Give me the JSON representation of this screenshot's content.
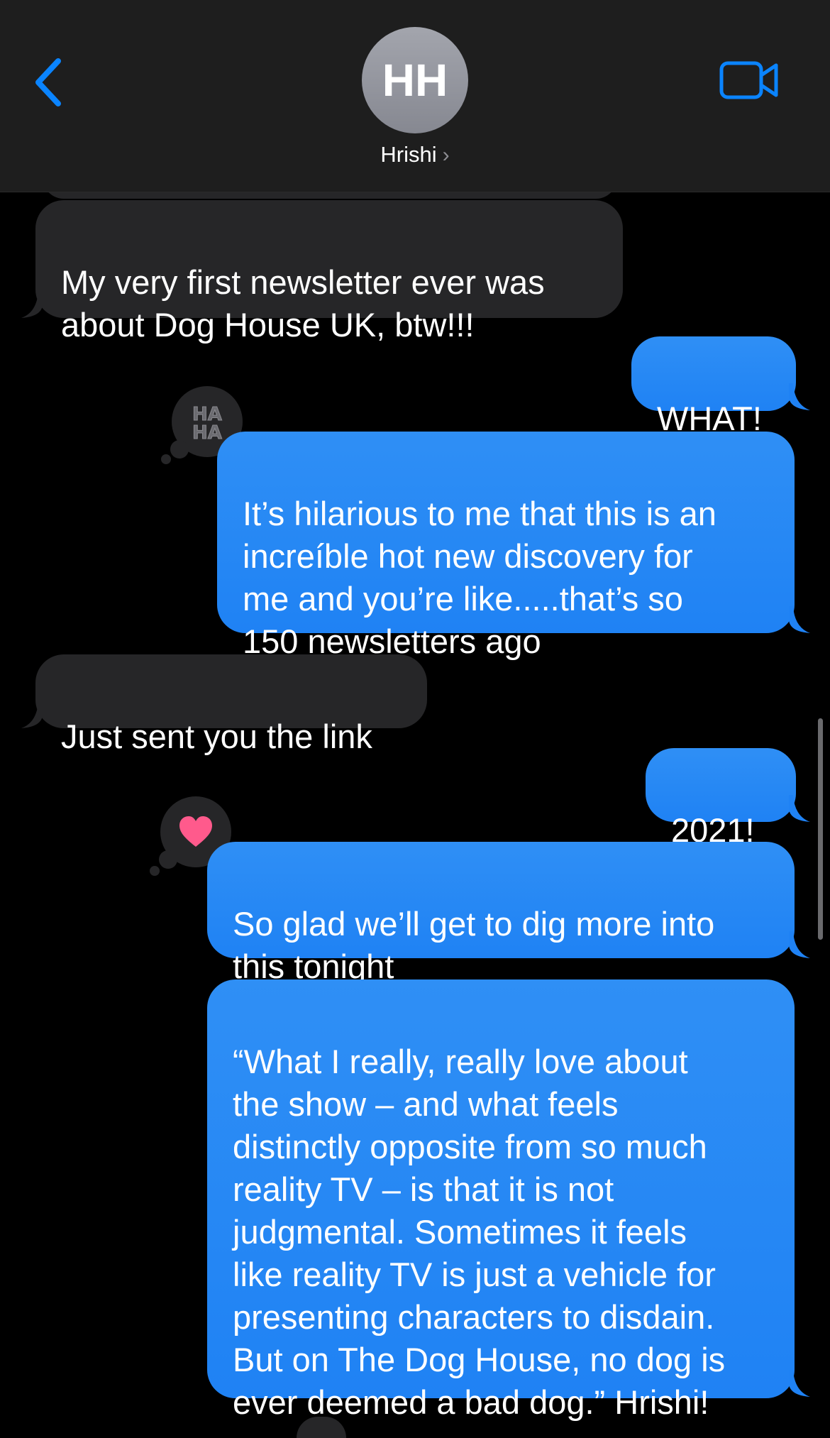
{
  "header": {
    "contact_initials": "HH",
    "contact_name": "Hrishi",
    "chevron": "›",
    "back_icon": "chevron-left-icon",
    "video_icon": "video-camera-icon",
    "accent_color": "#0a84ff"
  },
  "messages": [
    {
      "direction": "incoming",
      "text": "My very first newsletter ever was\nabout Dog House UK, btw!!!"
    },
    {
      "direction": "outgoing",
      "text": "WHAT!"
    },
    {
      "direction": "outgoing",
      "text": "It’s hilarious to me that this is an\nincreíble hot new discovery for\nme and you’re like.....that’s so\n150 newsletters ago",
      "tapback": "haha"
    },
    {
      "direction": "incoming",
      "text": "Just sent you the link"
    },
    {
      "direction": "outgoing",
      "text": "2021!"
    },
    {
      "direction": "outgoing",
      "text": "So glad we’ll get to dig more into\nthis tonight",
      "tapback": "heart"
    },
    {
      "direction": "outgoing",
      "text": "“What I really, really love about\nthe show – and what feels\ndistinctly opposite from so much\nreality TV – is that it is not\njudgmental. Sometimes it feels\nlike reality TV is just a vehicle for\npresenting characters to disdain.\nBut on The Dog House, no dog is\never deemed a bad dog.” Hrishi!"
    }
  ],
  "tapbacks": {
    "haha_label": "HA HA",
    "haha_icon": "haha-icon",
    "heart_icon": "heart-icon",
    "heart_color": "#ff5a8c"
  },
  "colors": {
    "incoming_bubble": "#262628",
    "outgoing_bubble": "#1f82f4",
    "background": "#000000",
    "header_background": "#1e1e1e"
  }
}
